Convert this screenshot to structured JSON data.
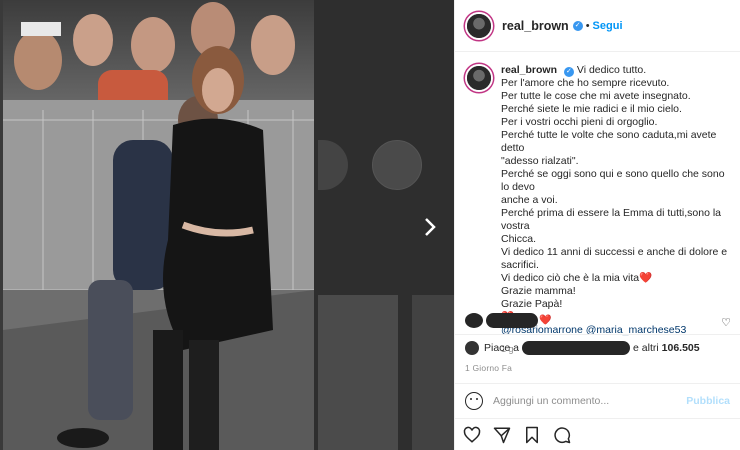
{
  "background": {
    "texts": [
      "...",
      "...",
      "..."
    ]
  },
  "post": {
    "username": "real_brown",
    "follow_label": "Segui",
    "dot": "•",
    "caption": {
      "username": "real_brown",
      "lines": [
        "Vi dedico tutto.",
        "Per l'amore che ho sempre ricevuto.",
        "Per tutte le cose che mi avete insegnato.",
        "Perché siete le mie radici e il mio cielo.",
        "Per i vostri occhi pieni di orgoglio.",
        "Perché tutte le volte che sono caduta,mi avete detto",
        "\"adesso rialzati\".",
        "Perché se oggi sono qui e sono quello che sono lo devo",
        "anche a voi.",
        "Perché prima di essere la Emma di tutti,sono la vostra",
        "Chicca.",
        "Vi dedico 11 anni di successi e anche di dolore e sacrifici.",
        "Vi dedico ciò che è la mia vita"
      ],
      "thanks_mom": "Grazie mamma!",
      "thanks_dad": "Grazie Papà!",
      "heart": "❤️",
      "mentions": "@rosariomarrone @maria_marchese53",
      "time": "1 g"
    },
    "likes": {
      "prefix": "Piace a",
      "suffix": "e altri",
      "count": "106.505"
    },
    "posted": "1 Giorno Fa",
    "comment": {
      "placeholder": "Aggiungi un commento...",
      "publish_label": "Pubblica"
    }
  }
}
